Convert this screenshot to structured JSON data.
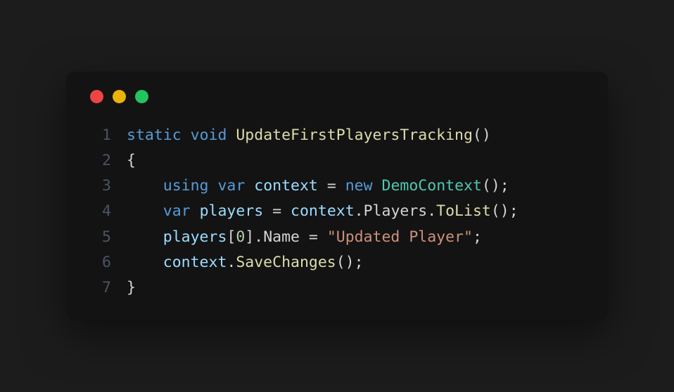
{
  "window": {
    "controls": {
      "close_color": "#ef4444",
      "minimize_color": "#eab308",
      "maximize_color": "#22c55e"
    }
  },
  "code": {
    "language": "csharp",
    "lines": [
      {
        "number": "1",
        "tokens": [
          {
            "text": "static",
            "type": "keyword"
          },
          {
            "text": " ",
            "type": "plain"
          },
          {
            "text": "void",
            "type": "keyword"
          },
          {
            "text": " ",
            "type": "plain"
          },
          {
            "text": "UpdateFirstPlayersTracking",
            "type": "method"
          },
          {
            "text": "()",
            "type": "punct"
          }
        ]
      },
      {
        "number": "2",
        "tokens": [
          {
            "text": "{",
            "type": "punct"
          }
        ]
      },
      {
        "number": "3",
        "tokens": [
          {
            "text": "    ",
            "type": "plain"
          },
          {
            "text": "using",
            "type": "keyword"
          },
          {
            "text": " ",
            "type": "plain"
          },
          {
            "text": "var",
            "type": "keyword"
          },
          {
            "text": " ",
            "type": "plain"
          },
          {
            "text": "context",
            "type": "identifier"
          },
          {
            "text": " ",
            "type": "plain"
          },
          {
            "text": "=",
            "type": "operator"
          },
          {
            "text": " ",
            "type": "plain"
          },
          {
            "text": "new",
            "type": "keyword"
          },
          {
            "text": " ",
            "type": "plain"
          },
          {
            "text": "DemoContext",
            "type": "type"
          },
          {
            "text": "();",
            "type": "punct"
          }
        ]
      },
      {
        "number": "4",
        "tokens": [
          {
            "text": "    ",
            "type": "plain"
          },
          {
            "text": "var",
            "type": "keyword"
          },
          {
            "text": " ",
            "type": "plain"
          },
          {
            "text": "players",
            "type": "identifier"
          },
          {
            "text": " ",
            "type": "plain"
          },
          {
            "text": "=",
            "type": "operator"
          },
          {
            "text": " ",
            "type": "plain"
          },
          {
            "text": "context",
            "type": "identifier"
          },
          {
            "text": ".",
            "type": "punct"
          },
          {
            "text": "Players",
            "type": "property"
          },
          {
            "text": ".",
            "type": "punct"
          },
          {
            "text": "ToList",
            "type": "method"
          },
          {
            "text": "();",
            "type": "punct"
          }
        ]
      },
      {
        "number": "5",
        "tokens": [
          {
            "text": "    ",
            "type": "plain"
          },
          {
            "text": "players",
            "type": "identifier"
          },
          {
            "text": "[",
            "type": "punct"
          },
          {
            "text": "0",
            "type": "number"
          },
          {
            "text": "].",
            "type": "punct"
          },
          {
            "text": "Name",
            "type": "property"
          },
          {
            "text": " ",
            "type": "plain"
          },
          {
            "text": "=",
            "type": "operator"
          },
          {
            "text": " ",
            "type": "plain"
          },
          {
            "text": "\"Updated Player\"",
            "type": "string"
          },
          {
            "text": ";",
            "type": "punct"
          }
        ]
      },
      {
        "number": "6",
        "tokens": [
          {
            "text": "    ",
            "type": "plain"
          },
          {
            "text": "context",
            "type": "identifier"
          },
          {
            "text": ".",
            "type": "punct"
          },
          {
            "text": "SaveChanges",
            "type": "method"
          },
          {
            "text": "();",
            "type": "punct"
          }
        ]
      },
      {
        "number": "7",
        "tokens": [
          {
            "text": "}",
            "type": "punct"
          }
        ]
      }
    ]
  }
}
